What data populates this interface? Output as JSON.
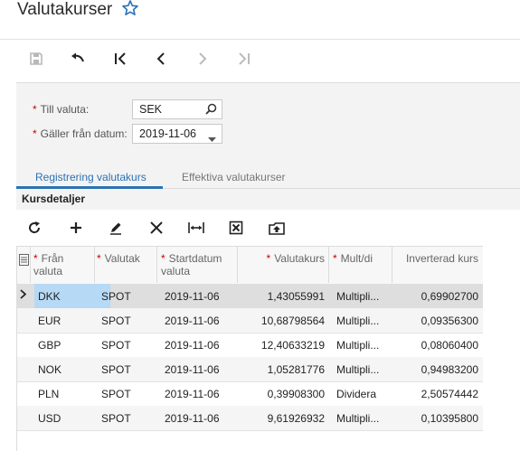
{
  "header": {
    "title": "Valutakurser"
  },
  "form": {
    "till_valuta": {
      "label": "Till valuta:",
      "value": "SEK"
    },
    "galler_fran": {
      "label": "Gäller från datum:",
      "value": "2019-11-06"
    }
  },
  "tabs": [
    {
      "label": "Registrering valutakurs"
    },
    {
      "label": "Effektiva valutakurser"
    }
  ],
  "section": {
    "title": "Kursdetaljer"
  },
  "grid": {
    "columns": [
      {
        "label": "Från valuta",
        "required": true
      },
      {
        "label": "Valutak",
        "required": true
      },
      {
        "label": "Startdatum valuta",
        "required": true
      },
      {
        "label": "Valutakurs",
        "required": true
      },
      {
        "label": "Mult/di",
        "required": true
      },
      {
        "label": "Inverterad kurs",
        "required": false
      }
    ],
    "rows": [
      {
        "from": "DKK",
        "type": "SPOT",
        "start": "2019-11-06",
        "rate": "1,43055991",
        "mult": "Multipli...",
        "inv": "0,69902700"
      },
      {
        "from": "EUR",
        "type": "SPOT",
        "start": "2019-11-06",
        "rate": "10,68798564",
        "mult": "Multipli...",
        "inv": "0,09356300"
      },
      {
        "from": "GBP",
        "type": "SPOT",
        "start": "2019-11-06",
        "rate": "12,40633219",
        "mult": "Multipli...",
        "inv": "0,08060400"
      },
      {
        "from": "NOK",
        "type": "SPOT",
        "start": "2019-11-06",
        "rate": "1,05281776",
        "mult": "Multipli...",
        "inv": "0,94983200"
      },
      {
        "from": "PLN",
        "type": "SPOT",
        "start": "2019-11-06",
        "rate": "0,39908300",
        "mult": "Dividera",
        "inv": "2,50574442"
      },
      {
        "from": "USD",
        "type": "SPOT",
        "start": "2019-11-06",
        "rate": "9,61926932",
        "mult": "Multipli...",
        "inv": "0,10395800"
      }
    ]
  },
  "icons": {
    "star": "star-icon",
    "save": "save-icon",
    "undo": "undo-icon",
    "first": "first-page-icon",
    "prev": "previous-icon",
    "next": "next-icon",
    "last": "last-page-icon",
    "search": "search-icon",
    "dropdown": "chevron-down-icon",
    "refresh": "refresh-icon",
    "add": "add-icon",
    "edit": "edit-icon",
    "delete": "delete-icon",
    "fit": "fit-columns-icon",
    "excel": "export-excel-icon",
    "upload": "upload-icon"
  },
  "colors": {
    "accent": "#2b72b5",
    "required": "#c00000",
    "selected": "#b6d9f5"
  }
}
